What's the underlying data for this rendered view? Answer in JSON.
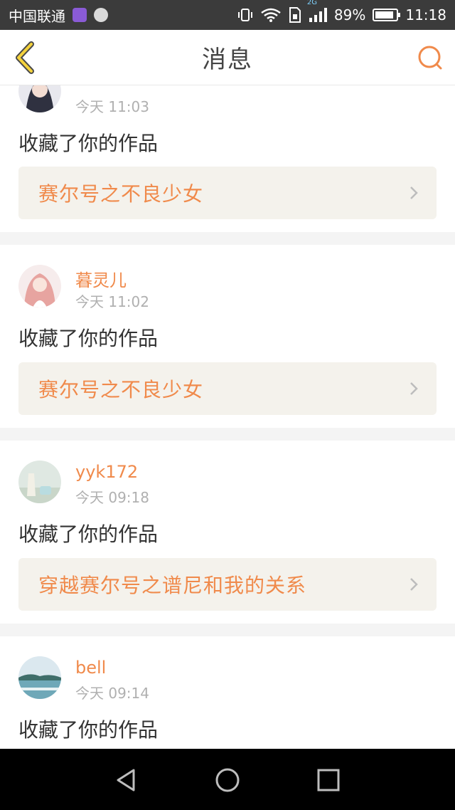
{
  "status_bar": {
    "carrier": "中国联通",
    "network": "2G",
    "battery": "89%",
    "battery_level": 0.89,
    "time": "11:18"
  },
  "header": {
    "title": "消息",
    "back_icon": "back-chevron-icon",
    "search_icon": "search-icon"
  },
  "colors": {
    "accent": "#f08a4b",
    "card_link_bg": "#f4f2ec",
    "divider": "#f4f4f4"
  },
  "messages": [
    {
      "username": "",
      "time": "今天 11:03",
      "action": "收藏了你的作品",
      "work_title": "赛尔号之不良少女"
    },
    {
      "username": "暮灵儿",
      "time": "今天 11:02",
      "action": "收藏了你的作品",
      "work_title": "赛尔号之不良少女"
    },
    {
      "username": "yyk172",
      "time": "今天 09:18",
      "action": "收藏了你的作品",
      "work_title": "穿越赛尔号之谱尼和我的关系"
    },
    {
      "username": "bell",
      "time": "今天 09:14",
      "action": "收藏了你的作品",
      "work_title": ""
    }
  ],
  "nav_bar": {
    "back_icon": "nav-back-icon",
    "home_icon": "nav-home-icon",
    "recents_icon": "nav-recents-icon"
  }
}
